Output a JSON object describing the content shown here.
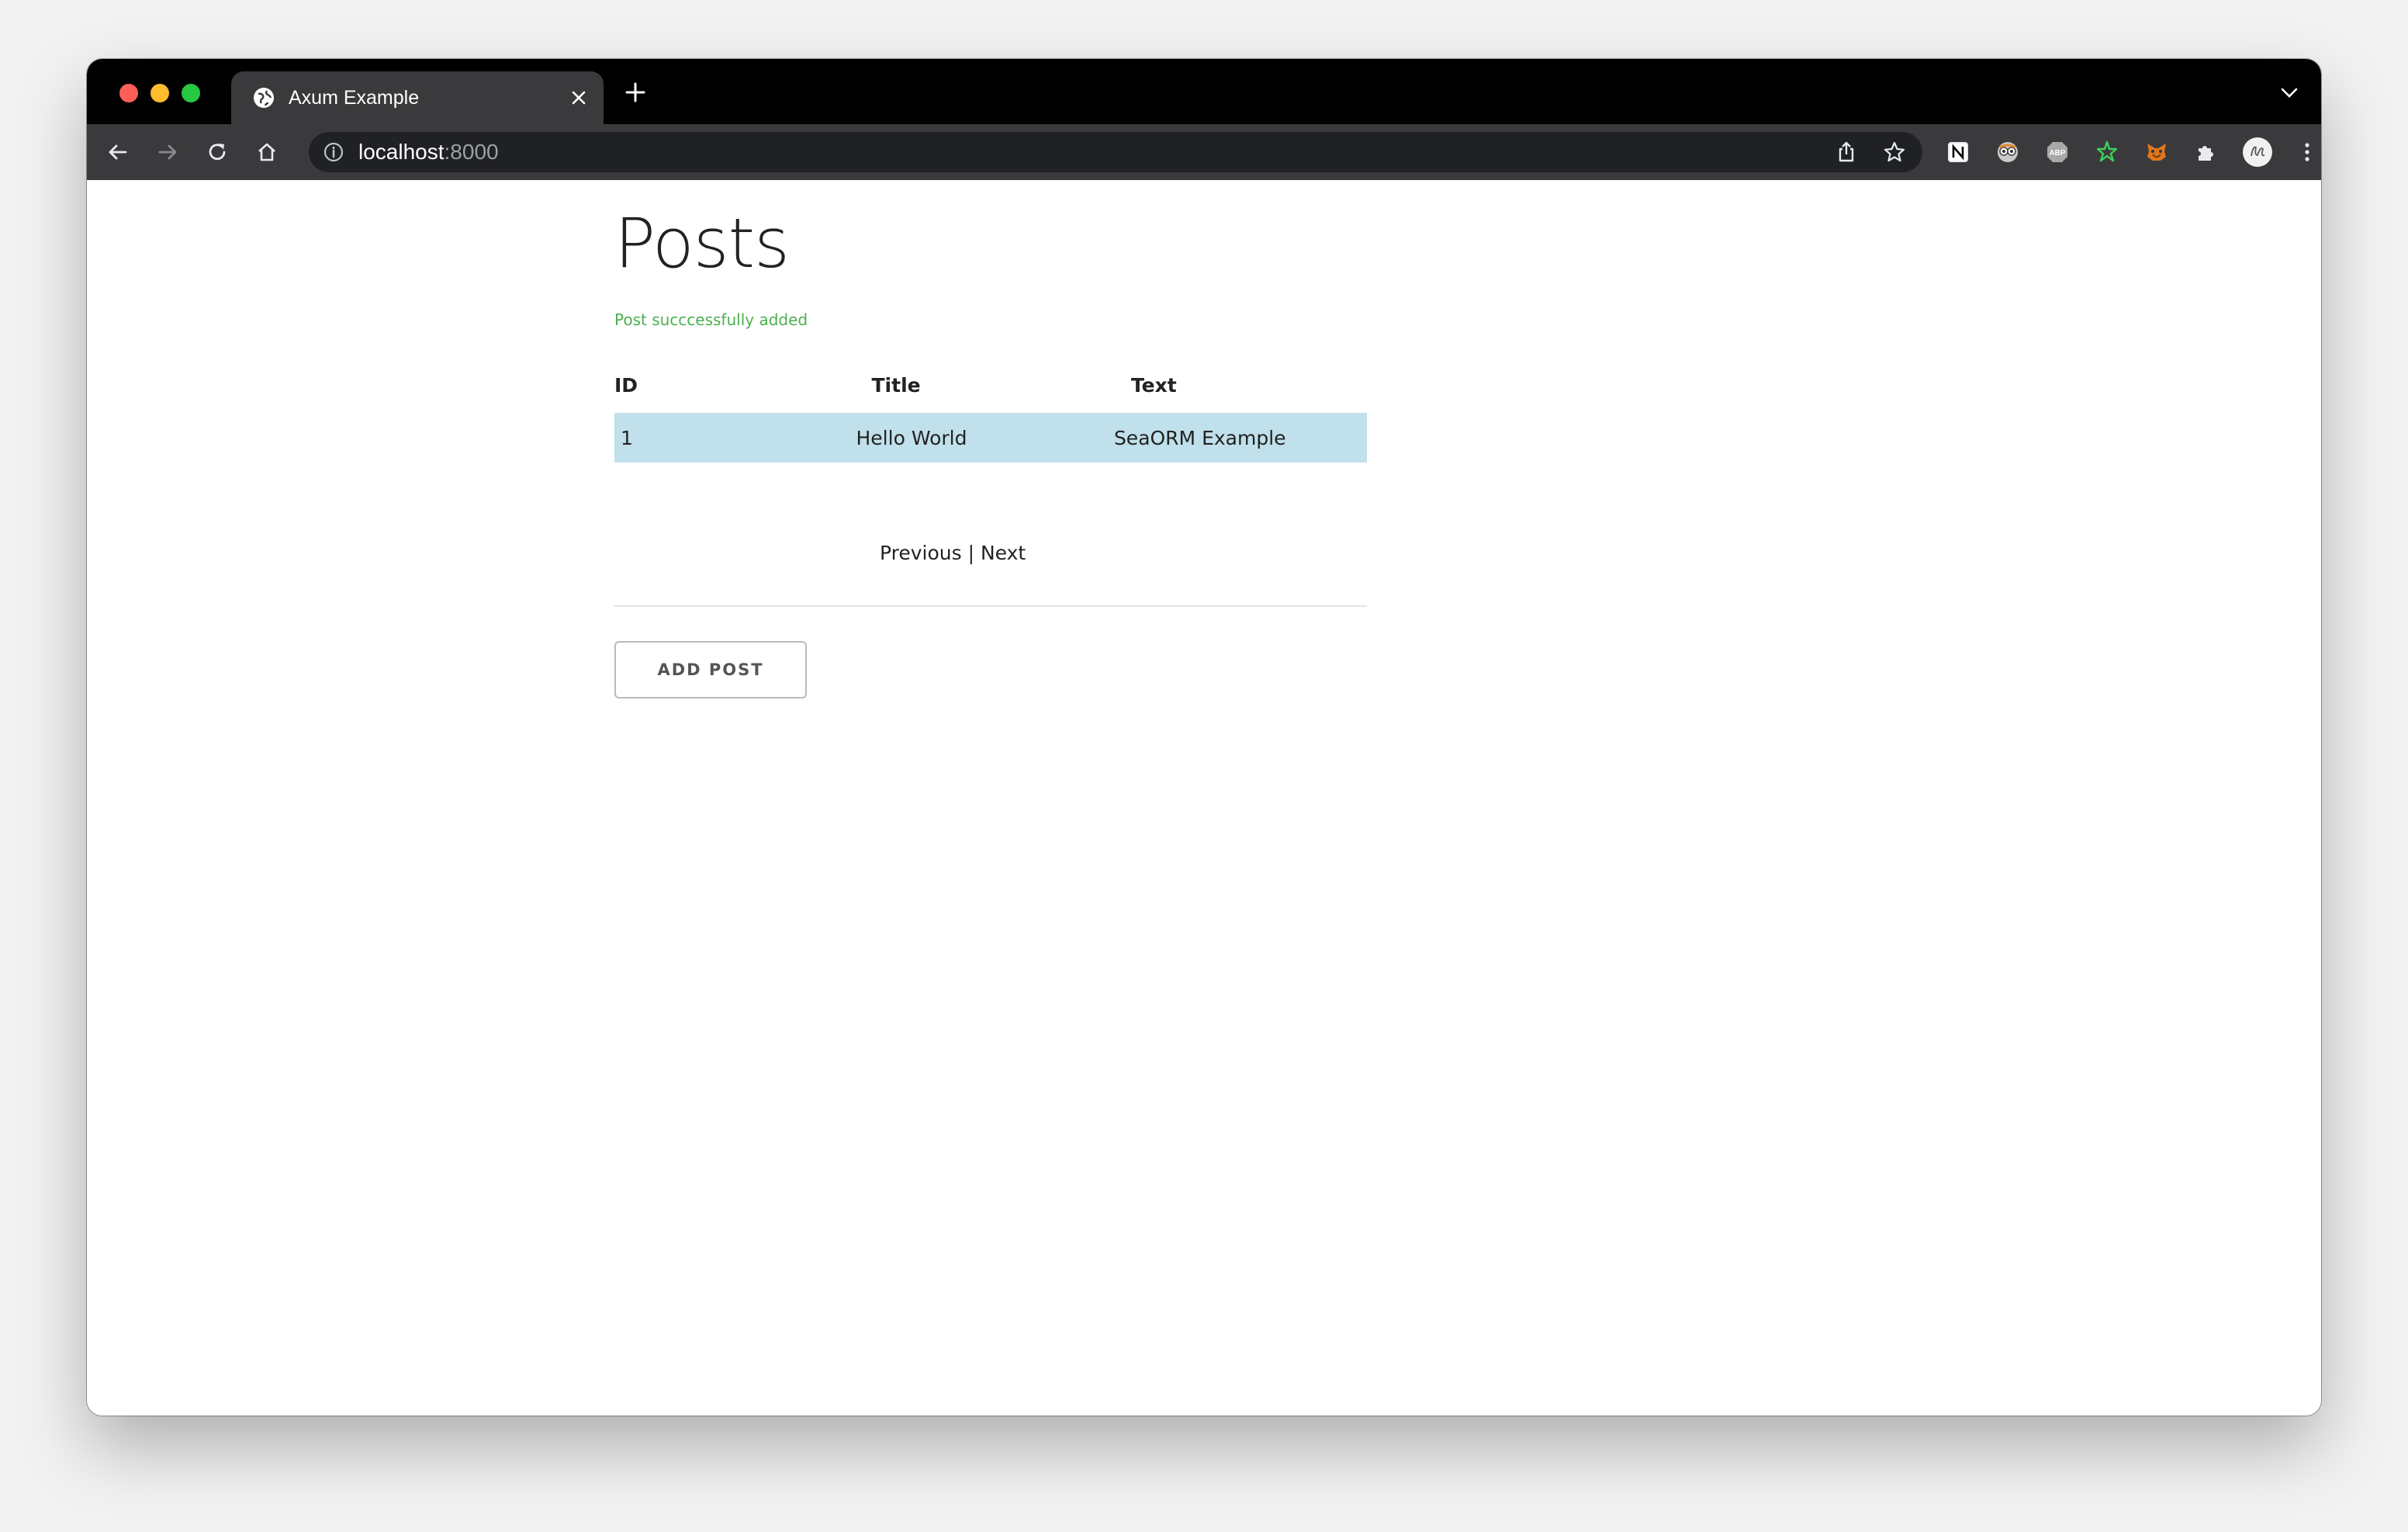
{
  "browser": {
    "tab_title": "Axum Example",
    "url_host": "localhost",
    "url_port": ":8000"
  },
  "page": {
    "title": "Posts",
    "flash_message": "Post succcessfully added",
    "columns": [
      "ID",
      "Title",
      "Text"
    ],
    "rows": [
      {
        "id": "1",
        "title": "Hello World",
        "text": "SeaORM Example"
      }
    ],
    "pager": {
      "previous": "Previous",
      "separator": " | ",
      "next": "Next"
    },
    "add_button": "ADD POST"
  },
  "colors": {
    "flash": "#4caf50",
    "row_highlight": "#c0e0eb",
    "tabbar": "#000000",
    "toolbar": "#3a3a3c"
  },
  "icons": [
    "globe-icon",
    "close-icon",
    "plus-icon",
    "chevron-down-icon",
    "back-arrow-icon",
    "forward-arrow-icon",
    "reload-icon",
    "home-icon",
    "info-icon",
    "share-icon",
    "star-icon",
    "notion-icon",
    "extension-eyes-icon",
    "adblock-icon",
    "extension-star-icon",
    "metamask-fox-icon",
    "puzzle-icon",
    "avatar",
    "more-vert-icon"
  ]
}
